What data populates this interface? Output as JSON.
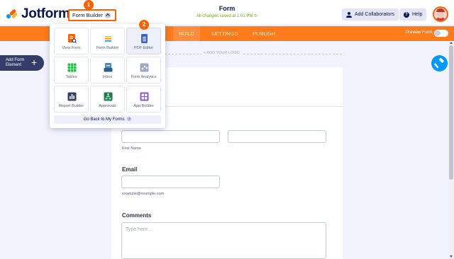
{
  "header": {
    "brand": "Jotform",
    "form_builder_label": "Form Builder",
    "step1": "1",
    "step2": "2",
    "form_title": "Form",
    "save_status": "All changes saved at 1:01 PM ↻",
    "add_collaborators": "Add Collaborators",
    "help": "Help",
    "help_icon": "?"
  },
  "nav": {
    "tabs": [
      "BUILD",
      "SETTINGS",
      "PUBLISH"
    ],
    "active_tab": "BUILD",
    "preview_label": "Preview Form",
    "preview_on": false
  },
  "sidebar": {
    "add_element_line1": "Add Form",
    "add_element_line2": "Element",
    "plus": "+"
  },
  "canvas": {
    "add_logo": "+ ADD YOUR LOGO",
    "first_name_sub": "First Name",
    "email_label": "Email",
    "email_sub": "example@example.com",
    "comments_label": "Comments",
    "comments_placeholder": "Type here..."
  },
  "dropdown": {
    "items": [
      {
        "label": "View Form",
        "icon": "view-form-icon",
        "color": "#ff6100"
      },
      {
        "label": "Form Builder",
        "icon": "form-builder-icon",
        "color": "#ff9500"
      },
      {
        "label": "PDF Editor",
        "icon": "pdf-editor-icon",
        "color": "#3e62c8"
      },
      {
        "label": "Tables",
        "icon": "tables-icon",
        "color": "#2db84c"
      },
      {
        "label": "Inbox",
        "icon": "inbox-icon",
        "color": "#4b8bbe"
      },
      {
        "label": "Form Analytics",
        "icon": "analytics-icon",
        "color": "#9da8c8"
      },
      {
        "label": "Report Builder",
        "icon": "report-builder-icon",
        "color": "#344067"
      },
      {
        "label": "Approvals",
        "icon": "approvals-icon",
        "color": "#1d7a53"
      },
      {
        "label": "App Builder",
        "icon": "app-builder-icon",
        "color": "#8a55c7"
      }
    ],
    "go_back": "Go Back to My Forms",
    "go_back_arrow": "›"
  },
  "colors": {
    "accent": "#ff6100",
    "nav": "#ff7b1c",
    "brand_dark": "#0a1551",
    "paint_button": "#0099ff"
  }
}
